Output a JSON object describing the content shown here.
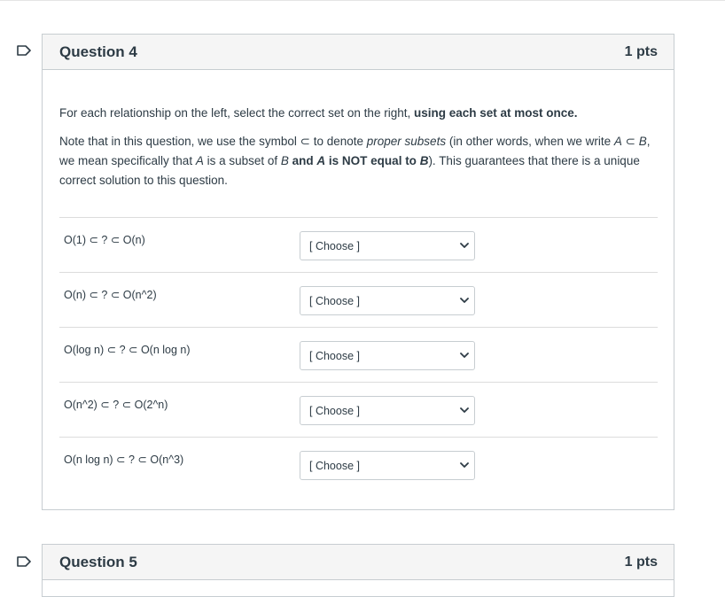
{
  "question4": {
    "title": "Question 4",
    "points": "1 pts",
    "instruction_plain": "For each relationship on the left, select the correct set on the right, ",
    "instruction_bold": "using each set at most once.",
    "note": {
      "t1": "Note that in this question, we use the symbol ⊂ to denote ",
      "t2": "proper subsets",
      "t3": " (in other words, when we write ",
      "t4": "A",
      "t5": " ⊂ ",
      "t6": "B",
      "t7": ", we mean specifically that ",
      "t8": "A",
      "t9": " is a subset of ",
      "t10": "B",
      "t11": " and ",
      "t12": "A",
      "t13": " is NOT equal to ",
      "t14": "B",
      "t15": "). This guarantees that there is a unique correct solution to this question."
    },
    "rows": [
      {
        "label": "O(1) ⊂ ? ⊂ O(n)",
        "selected": "[ Choose ]"
      },
      {
        "label": "O(n) ⊂ ? ⊂ O(n^2)",
        "selected": "[ Choose ]"
      },
      {
        "label": "O(log n) ⊂ ? ⊂ O(n log n)",
        "selected": "[ Choose ]"
      },
      {
        "label": "O(n^2) ⊂ ? ⊂ O(2^n)",
        "selected": "[ Choose ]"
      },
      {
        "label": "O(n log n) ⊂ ? ⊂ O(n^3)",
        "selected": "[ Choose ]"
      }
    ]
  },
  "question5": {
    "title": "Question 5",
    "points": "1 pts"
  },
  "icons": {
    "flag": "flag-icon",
    "chevron": "chevron-down-icon"
  },
  "colors": {
    "text": "#2d3b45",
    "border": "#c7cdd1",
    "header_bg": "#f5f5f5",
    "divider": "#dcdcdc"
  }
}
